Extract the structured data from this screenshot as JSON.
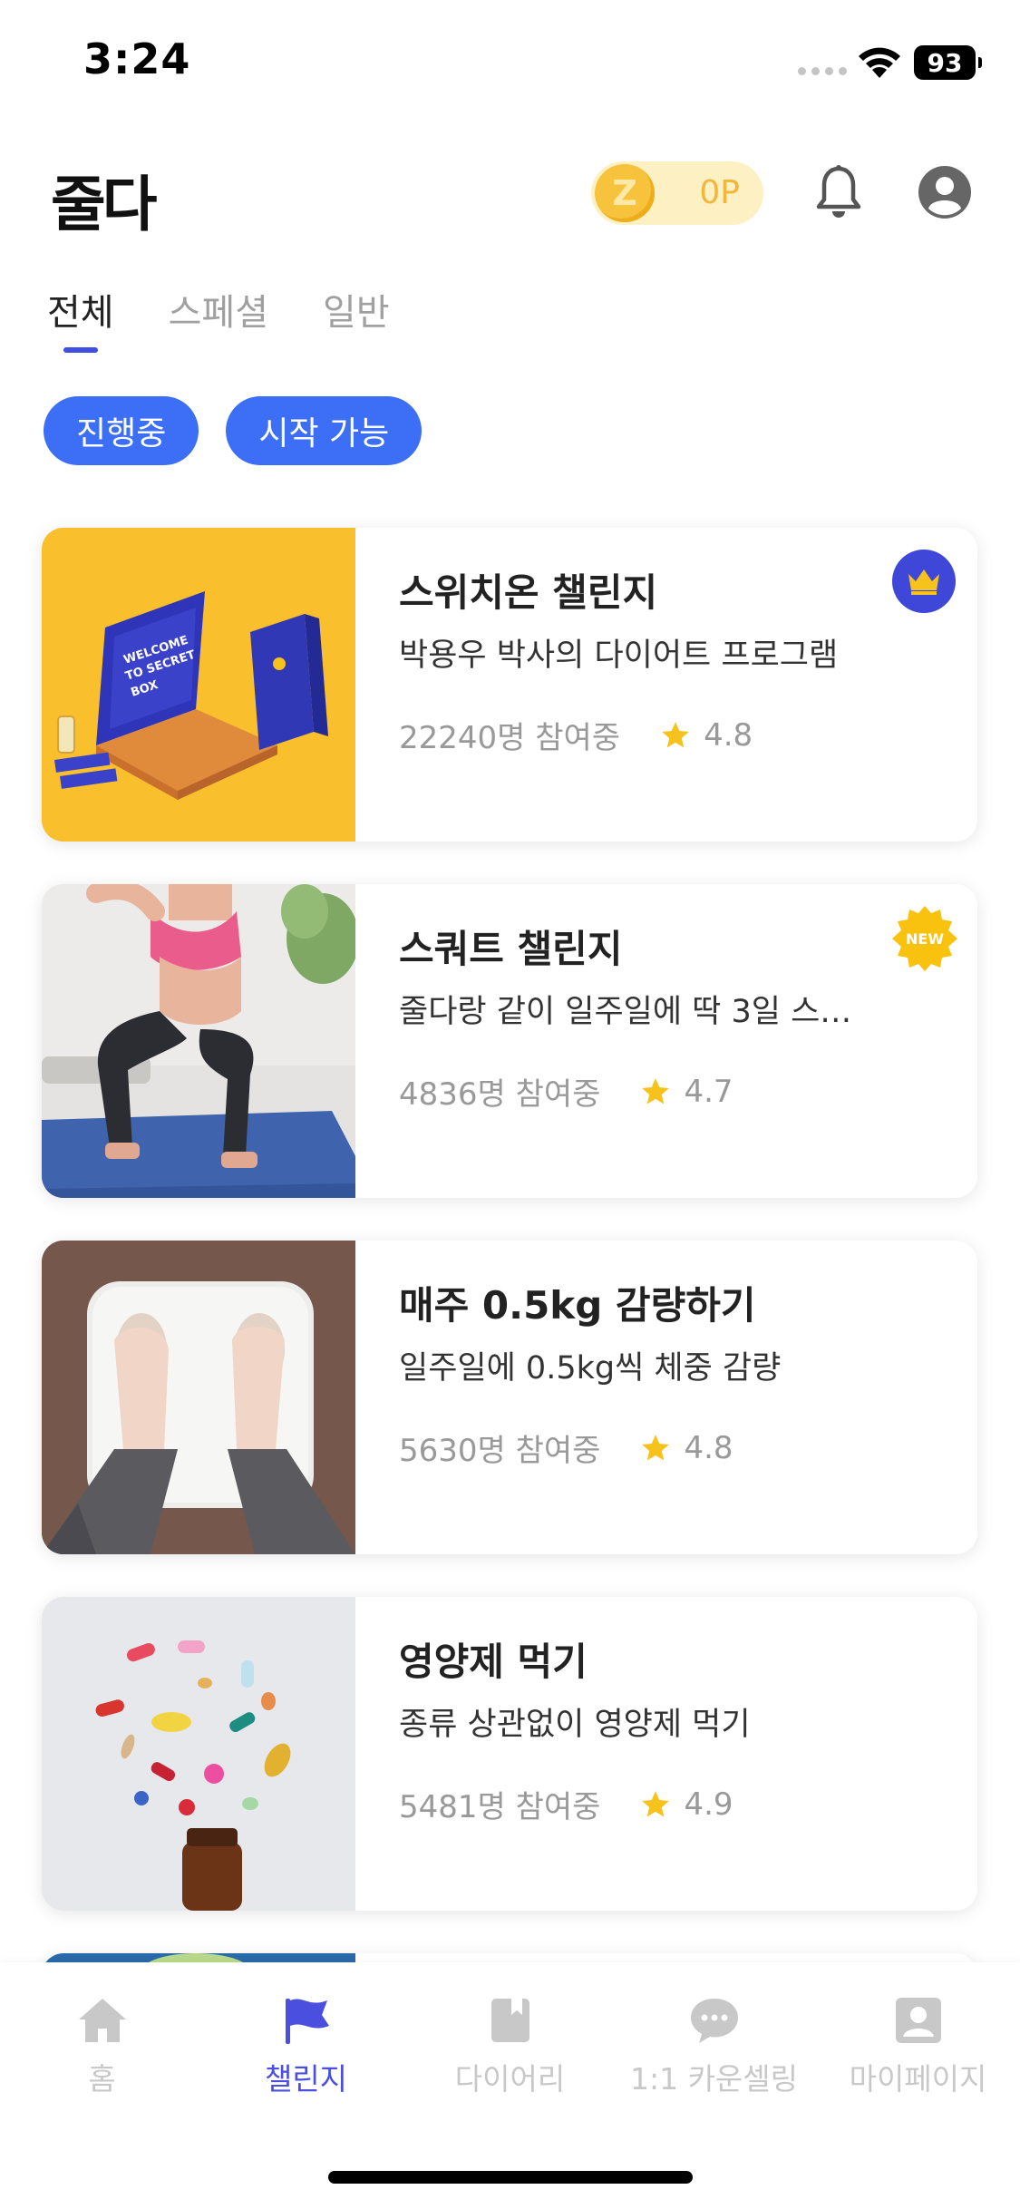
{
  "status_bar": {
    "time": "3:24",
    "battery": "93"
  },
  "header": {
    "logo": "줄다",
    "points": "0P",
    "coin_symbol": "Z"
  },
  "tabs": [
    {
      "label": "전체",
      "active": true
    },
    {
      "label": "스페셜",
      "active": false
    },
    {
      "label": "일반",
      "active": false
    }
  ],
  "filters": [
    {
      "label": "진행중"
    },
    {
      "label": "시작 가능"
    }
  ],
  "cards": [
    {
      "title": "스위치온 챌린지",
      "description": "박용우 박사의 다이어트 프로그램",
      "participants": "22240명 참여중",
      "rating": "4.8",
      "badge": "crown-icon",
      "image": "switch-on-box-photo"
    },
    {
      "title": "스쿼트 챌린지",
      "description": "줄다랑 같이 일주일에 딱 3일 스…",
      "participants": "4836명 참여중",
      "rating": "4.7",
      "badge": "NEW",
      "image": "squat-photo"
    },
    {
      "title": "매주 0.5kg 감량하기",
      "description": "일주일에 0.5kg씩 체중 감량",
      "participants": "5630명 참여중",
      "rating": "4.8",
      "badge": "",
      "image": "scale-photo"
    },
    {
      "title": "영양제 먹기",
      "description": "종류 상관없이 영양제 먹기",
      "participants": "5481명 참여중",
      "rating": "4.9",
      "badge": "",
      "image": "supplements-photo"
    }
  ],
  "bottom_nav": [
    {
      "label": "홈",
      "icon": "home-icon",
      "active": false
    },
    {
      "label": "챌린지",
      "icon": "flag-icon",
      "active": true
    },
    {
      "label": "다이어리",
      "icon": "diary-icon",
      "active": false
    },
    {
      "label": "1:1 카운셀링",
      "icon": "chat-icon",
      "active": false
    },
    {
      "label": "마이페이지",
      "icon": "user-icon",
      "active": false
    }
  ],
  "colors": {
    "accent": "#3c6ef6",
    "brand_indigo": "#3f47d8",
    "star": "#f7c21c",
    "inactive": "#c8c8c8",
    "coin": "#f7c23c"
  }
}
